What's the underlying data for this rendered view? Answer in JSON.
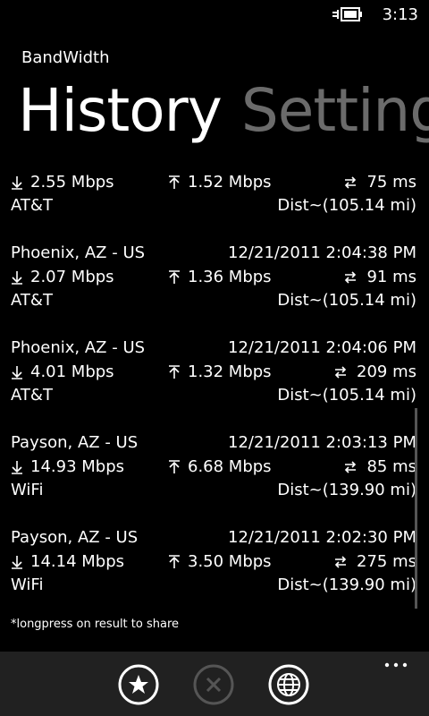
{
  "status": {
    "time": "3:13",
    "battery_icon": "battery-charging-icon"
  },
  "app": {
    "title": "BandWidth"
  },
  "pivot": {
    "active": "History",
    "next": "Setting"
  },
  "results": [
    {
      "location": "",
      "time": "",
      "download": "2.55 Mbps",
      "upload": "1.52 Mbps",
      "ping": "75 ms",
      "carrier": "AT&T",
      "distance": "Dist~(105.14 mi)"
    },
    {
      "location": "Phoenix, AZ - US",
      "time": "12/21/2011 2:04:38 PM",
      "download": "2.07 Mbps",
      "upload": "1.36 Mbps",
      "ping": "91 ms",
      "carrier": "AT&T",
      "distance": "Dist~(105.14 mi)"
    },
    {
      "location": "Phoenix, AZ - US",
      "time": "12/21/2011 2:04:06 PM",
      "download": "4.01 Mbps",
      "upload": "1.32 Mbps",
      "ping": "209 ms",
      "carrier": "AT&T",
      "distance": "Dist~(105.14 mi)"
    },
    {
      "location": "Payson, AZ - US",
      "time": "12/21/2011 2:03:13 PM",
      "download": "14.93 Mbps",
      "upload": "6.68 Mbps",
      "ping": "85 ms",
      "carrier": "WiFi",
      "distance": "Dist~(139.90 mi)"
    },
    {
      "location": "Payson, AZ - US",
      "time": "12/21/2011 2:02:30 PM",
      "download": "14.14 Mbps",
      "upload": "3.50 Mbps",
      "ping": "275 ms",
      "carrier": "WiFi",
      "distance": "Dist~(139.90 mi)"
    }
  ],
  "footnote": "*longpress on result to share",
  "app_bar": {
    "buttons": [
      {
        "icon": "star-icon",
        "enabled": true
      },
      {
        "icon": "close-icon",
        "enabled": false
      },
      {
        "icon": "globe-icon",
        "enabled": true
      }
    ],
    "more_icon": "more-dots-icon"
  },
  "colors": {
    "background": "#000000",
    "foreground": "#ffffff",
    "inactive": "#6b6b6b",
    "app_bar": "#212121"
  }
}
